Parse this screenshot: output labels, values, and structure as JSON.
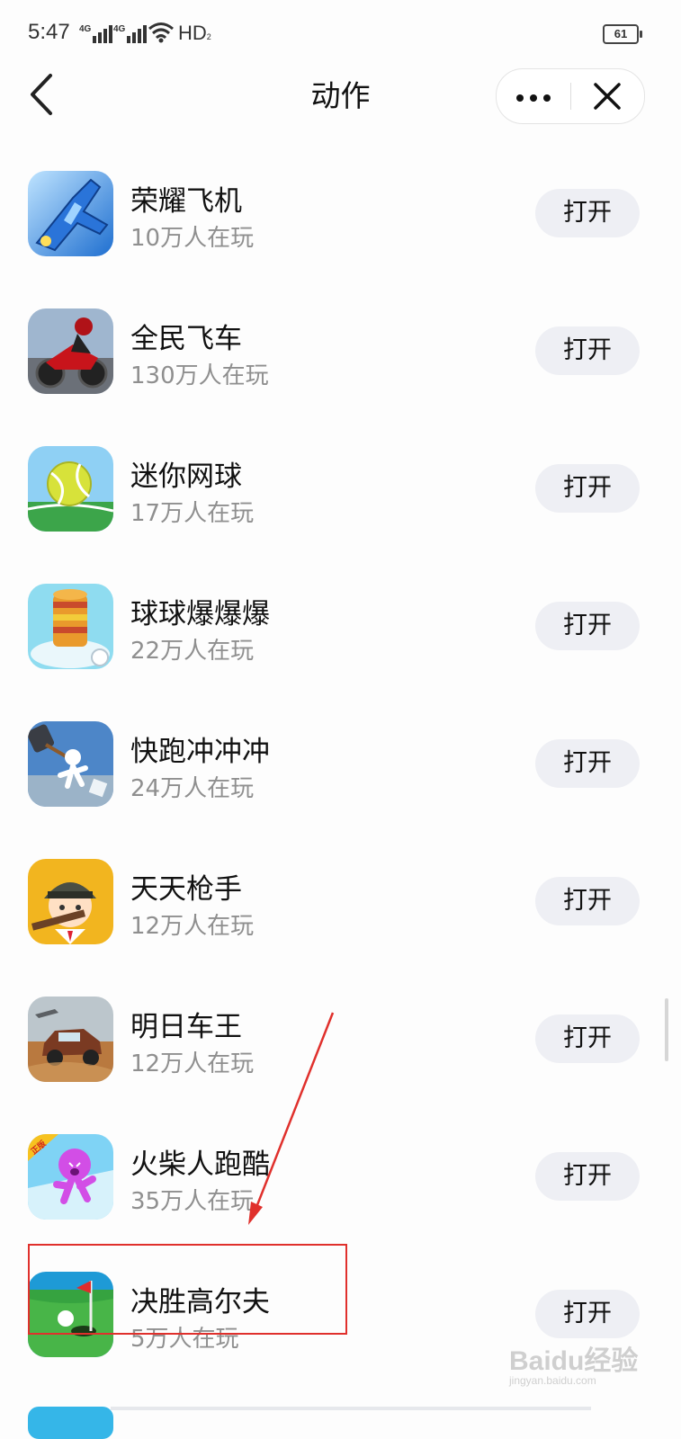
{
  "status_bar": {
    "time": "5:47",
    "signal1_label": "4G",
    "signal2_label": "4G",
    "hd_label": "HD",
    "hd_sub": "2",
    "battery": "61"
  },
  "header": {
    "title": "动作"
  },
  "games": [
    {
      "name": "荣耀飞机",
      "players": "10万人在玩",
      "button": "打开",
      "icon": "jet-fighter-icon"
    },
    {
      "name": "全民飞车",
      "players": "130万人在玩",
      "button": "打开",
      "icon": "motorcycle-icon"
    },
    {
      "name": "迷你网球",
      "players": "17万人在玩",
      "button": "打开",
      "icon": "tennis-ball-icon"
    },
    {
      "name": "球球爆爆爆",
      "players": "22万人在玩",
      "button": "打开",
      "icon": "stacked-rings-icon"
    },
    {
      "name": "快跑冲冲冲",
      "players": "24万人在玩",
      "button": "打开",
      "icon": "runner-hammer-icon"
    },
    {
      "name": "天天枪手",
      "players": "12万人在玩",
      "button": "打开",
      "icon": "helmet-gunner-icon"
    },
    {
      "name": "明日车王",
      "players": "12万人在玩",
      "button": "打开",
      "icon": "offroad-truck-icon"
    },
    {
      "name": "火柴人跑酷",
      "players": "35万人在玩",
      "button": "打开",
      "icon": "purple-runner-icon",
      "icon_badge": "正版"
    },
    {
      "name": "决胜高尔夫",
      "players": "5万人在玩",
      "button": "打开",
      "icon": "golf-flag-icon"
    }
  ],
  "watermark": {
    "text": "Baidu经验",
    "sub": "jingyan.baidu.com"
  },
  "colors": {
    "annotation_red": "#e0302c",
    "button_bg": "#eeeff4"
  }
}
